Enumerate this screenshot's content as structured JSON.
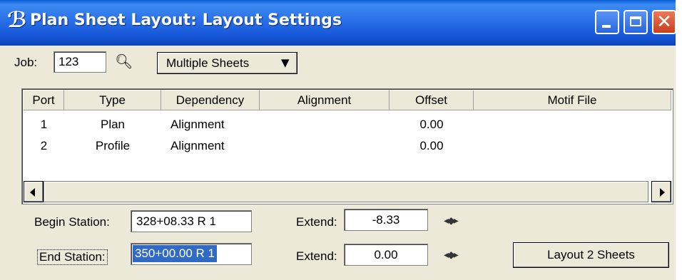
{
  "window": {
    "title": "Plan Sheet Layout: Layout Settings",
    "app_icon_glyph": "ℬ",
    "controls": {
      "minimize_icon": "minimize-icon",
      "maximize_icon": "maximize-icon",
      "close_glyph": "✕"
    }
  },
  "job": {
    "label": "Job:",
    "value": "123",
    "search_icon": "magnifier-icon",
    "search_glyph": "🔍︎",
    "mode": "Multiple Sheets",
    "mode_arrow": "▼"
  },
  "table": {
    "columns": [
      "Port",
      "Type",
      "Dependency",
      "Alignment",
      "Offset",
      "Motif File"
    ],
    "rows": [
      {
        "port": "1",
        "type": "Plan",
        "dependency": "Alignment",
        "alignment": "",
        "offset": "0.00",
        "motif": ""
      },
      {
        "port": "2",
        "type": "Profile",
        "dependency": "Alignment",
        "alignment": "",
        "offset": "0.00",
        "motif": ""
      }
    ]
  },
  "begin": {
    "label": "Begin Station:",
    "value": "328+08.33 R 1",
    "extend_label": "Extend:",
    "extend_value": "-8.33",
    "locate_glyph": "◂◆▸"
  },
  "end": {
    "label": "End Station:",
    "value": "350+00.00 R 1",
    "extend_label": "Extend:",
    "extend_value": "0.00",
    "locate_glyph": "◂◆▸"
  },
  "layout_button": "Layout 2 Sheets",
  "colors": {
    "title_blue": "#2a6fe8",
    "close_red": "#c8401e",
    "face": "#ece9d8",
    "selection": "#316ac5"
  }
}
